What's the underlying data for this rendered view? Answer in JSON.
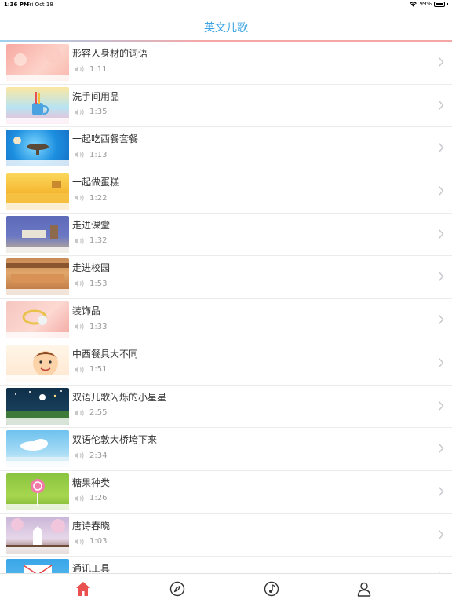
{
  "status_bar": {
    "time": "1:36 PM",
    "date": "Fri Oct 18",
    "battery": "99%",
    "battery_level": 0.99
  },
  "nav": {
    "title": "英文儿歌"
  },
  "colors": {
    "accent": "#3aa4e6",
    "tab_active": "#e9504f",
    "tab_inactive": "#333333"
  },
  "songs": [
    {
      "title": "形容人身材的词语",
      "duration": "1:11"
    },
    {
      "title": "洗手间用品",
      "duration": "1:35"
    },
    {
      "title": "一起吃西餐套餐",
      "duration": "1:13"
    },
    {
      "title": "一起做蛋糕",
      "duration": "1:22"
    },
    {
      "title": "走进课堂",
      "duration": "1:32"
    },
    {
      "title": "走进校园",
      "duration": "1:53"
    },
    {
      "title": "装饰品",
      "duration": "1:33"
    },
    {
      "title": "中西餐具大不同",
      "duration": "1:51"
    },
    {
      "title": "双语儿歌闪烁的小星星",
      "duration": "2:55"
    },
    {
      "title": "双语伦敦大桥垮下来",
      "duration": "2:34"
    },
    {
      "title": "糖果种类",
      "duration": "1:26"
    },
    {
      "title": "唐诗春晓",
      "duration": "1:03"
    },
    {
      "title": "通讯工具",
      "duration": ""
    }
  ],
  "tabs": [
    {
      "icon": "home-icon",
      "active": true
    },
    {
      "icon": "compass-icon",
      "active": false
    },
    {
      "icon": "music-note-icon",
      "active": false
    },
    {
      "icon": "user-icon",
      "active": false
    }
  ]
}
